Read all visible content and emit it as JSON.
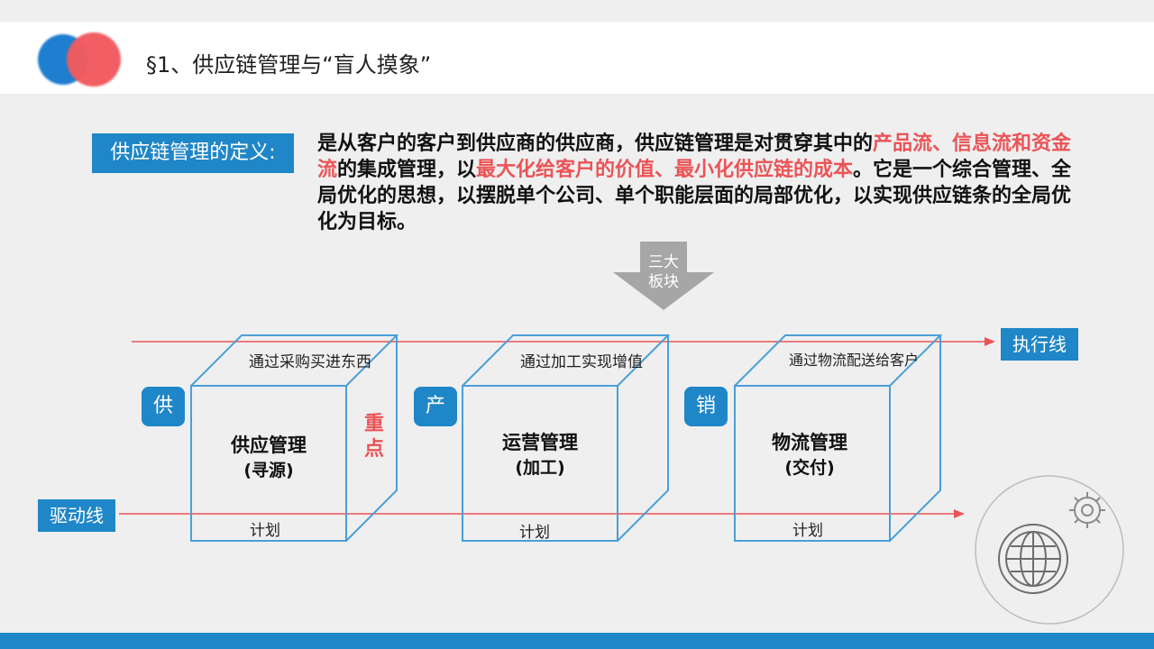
{
  "header": {
    "title": "§1、供应链管理与“盲人摸象”"
  },
  "definition": {
    "label": "供应链管理的定义:",
    "segments": [
      {
        "text": "是从客户的客户到供应商的供应商，供应链管理是对贯穿其中的",
        "highlight": false
      },
      {
        "text": "产品流、信息流和资金流",
        "highlight": true
      },
      {
        "text": "的集成管理，以",
        "highlight": false
      },
      {
        "text": "最大化给客户的价值、最小化供应链的成本",
        "highlight": true
      },
      {
        "text": "。它是一个综合管理、全局优化的思想，以摆脱单个公司、单个职能层面的局部优化，以实现供应链条的全局优化为目标。",
        "highlight": false
      }
    ]
  },
  "arrow_label": [
    "三大",
    "板块"
  ],
  "execution_line": {
    "label": "执行线"
  },
  "driving_line": {
    "label": "驱动线"
  },
  "focus_label": "重点",
  "cubes": [
    {
      "badge": "供",
      "top": "通过采购买进东西",
      "title": "供应管理",
      "subtitle": "(寻源)",
      "bottom": "计划"
    },
    {
      "badge": "产",
      "top": "通过加工实现增值",
      "title": "运营管理",
      "subtitle": "(加工)",
      "bottom": "计划"
    },
    {
      "badge": "销",
      "top": "通过物流配送给客户",
      "title": "物流管理",
      "subtitle": "(交付)",
      "bottom": "计划"
    }
  ],
  "colors": {
    "accent_blue": "#1f86c8",
    "accent_red": "#ea5457",
    "cube_line": "#4a9fd8",
    "arrow_gray": "#a6a6a6"
  },
  "icons": [
    "globe-icon",
    "gear-icon"
  ]
}
